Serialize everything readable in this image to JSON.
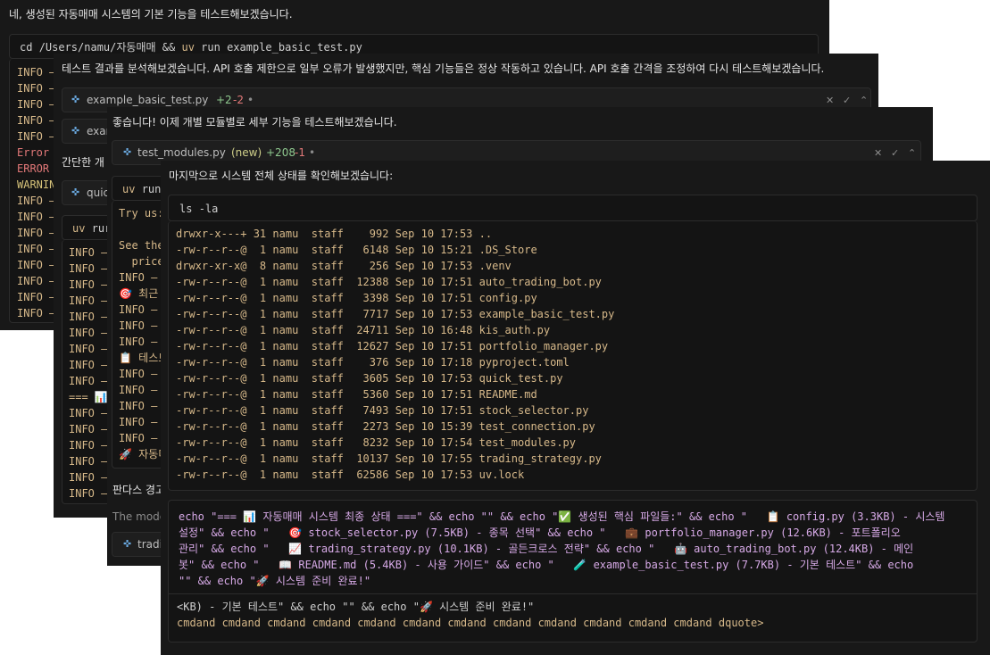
{
  "panel1": {
    "intro": "네, 생성된 자동매매 시스템의 기본 기능을 테스트해보겠습니다.",
    "command": {
      "cd": "cd",
      "path": "/Users/namu/자동매매",
      "amp": "&&",
      "uv": "uv",
      "run": "run",
      "file": "example_basic_test.py"
    },
    "log_lines": [
      "INFO –",
      "INFO –",
      "INFO –",
      "INFO –",
      "INFO –",
      "Error",
      "ERROR",
      "WARNIN",
      "INFO –",
      "INFO –",
      "INFO –",
      "INFO –",
      "INFO –",
      "INFO –",
      "INFO –",
      "INFO –"
    ]
  },
  "panel2": {
    "intro": "테스트 결과를 분석해보겠습니다. API 호출 제한으로 일부 오류가 발생했지만, 핵심 기능들은 정상 작동하고 있습니다. API 호출 간격을 조정하여 다시 테스트해보겠습니다.",
    "filebar": {
      "name": "example_basic_test.py",
      "added": "+2",
      "removed": "-2",
      "dot": "•"
    },
    "filebar2_name": "exar",
    "section_text": "간단한 개",
    "filebar3_name": "quic",
    "cmd_fragment": {
      "uv": "uv",
      "run": "rur"
    },
    "log_lines": [
      "INFO –",
      "INFO –",
      "INFO –",
      "INFO –",
      "INFO –",
      "INFO –",
      "INFO –",
      "INFO –",
      "INFO –",
      "=== 📊",
      "INFO –",
      "INFO –",
      "INFO –",
      "INFO –",
      "INFO –",
      "INFO –"
    ]
  },
  "panel3": {
    "intro": "좋습니다! 이제 개별 모듈별로 세부 기능을 테스트해보겠습니다.",
    "filebar": {
      "name": "test_modules.py",
      "new": "(new)",
      "added": "+208",
      "removed": "-1",
      "dot": "•"
    },
    "cmd_fragment": {
      "uv": "uv",
      "run": "run"
    },
    "out_lines": [
      "Try us:",
      "",
      "See the",
      "  price",
      "INFO –",
      "🎯 최근",
      "INFO –",
      "INFO –",
      "INFO –",
      "📋 테스트",
      "INFO –",
      "INFO –",
      "INFO –",
      "INFO –",
      "INFO –",
      "🚀 자동미"
    ],
    "bottom_text": "판다스 경고",
    "model_text": "The mode",
    "filebar2_name": "tradi"
  },
  "panel4": {
    "intro": "마지막으로 시스템 전체 상태를 확인해보겠습니다:",
    "command": {
      "ls": "ls",
      "flag": "-la"
    },
    "listing": [
      {
        "perm": "drwxr-x---+",
        "links": "31",
        "owner": "namu",
        "group": "staff",
        "size": "992",
        "month": "Sep",
        "day": "10",
        "time": "17:53",
        "name": ".."
      },
      {
        "perm": "-rw-r--r--@",
        "links": "1",
        "owner": "namu",
        "group": "staff",
        "size": "6148",
        "month": "Sep",
        "day": "10",
        "time": "15:21",
        "name": ".DS_Store"
      },
      {
        "perm": "drwxr-xr-x@",
        "links": "8",
        "owner": "namu",
        "group": "staff",
        "size": "256",
        "month": "Sep",
        "day": "10",
        "time": "17:53",
        "name": ".venv"
      },
      {
        "perm": "-rw-r--r--@",
        "links": "1",
        "owner": "namu",
        "group": "staff",
        "size": "12388",
        "month": "Sep",
        "day": "10",
        "time": "17:51",
        "name": "auto_trading_bot.py"
      },
      {
        "perm": "-rw-r--r--@",
        "links": "1",
        "owner": "namu",
        "group": "staff",
        "size": "3398",
        "month": "Sep",
        "day": "10",
        "time": "17:51",
        "name": "config.py"
      },
      {
        "perm": "-rw-r--r--@",
        "links": "1",
        "owner": "namu",
        "group": "staff",
        "size": "7717",
        "month": "Sep",
        "day": "10",
        "time": "17:53",
        "name": "example_basic_test.py"
      },
      {
        "perm": "-rw-r--r--@",
        "links": "1",
        "owner": "namu",
        "group": "staff",
        "size": "24711",
        "month": "Sep",
        "day": "10",
        "time": "16:48",
        "name": "kis_auth.py"
      },
      {
        "perm": "-rw-r--r--@",
        "links": "1",
        "owner": "namu",
        "group": "staff",
        "size": "12627",
        "month": "Sep",
        "day": "10",
        "time": "17:51",
        "name": "portfolio_manager.py"
      },
      {
        "perm": "-rw-r--r--@",
        "links": "1",
        "owner": "namu",
        "group": "staff",
        "size": "376",
        "month": "Sep",
        "day": "10",
        "time": "17:18",
        "name": "pyproject.toml"
      },
      {
        "perm": "-rw-r--r--@",
        "links": "1",
        "owner": "namu",
        "group": "staff",
        "size": "3605",
        "month": "Sep",
        "day": "10",
        "time": "17:53",
        "name": "quick_test.py"
      },
      {
        "perm": "-rw-r--r--@",
        "links": "1",
        "owner": "namu",
        "group": "staff",
        "size": "5360",
        "month": "Sep",
        "day": "10",
        "time": "17:51",
        "name": "README.md"
      },
      {
        "perm": "-rw-r--r--@",
        "links": "1",
        "owner": "namu",
        "group": "staff",
        "size": "7493",
        "month": "Sep",
        "day": "10",
        "time": "17:51",
        "name": "stock_selector.py"
      },
      {
        "perm": "-rw-r--r--@",
        "links": "1",
        "owner": "namu",
        "group": "staff",
        "size": "2273",
        "month": "Sep",
        "day": "10",
        "time": "15:39",
        "name": "test_connection.py"
      },
      {
        "perm": "-rw-r--r--@",
        "links": "1",
        "owner": "namu",
        "group": "staff",
        "size": "8232",
        "month": "Sep",
        "day": "10",
        "time": "17:54",
        "name": "test_modules.py"
      },
      {
        "perm": "-rw-r--r--@",
        "links": "1",
        "owner": "namu",
        "group": "staff",
        "size": "10137",
        "month": "Sep",
        "day": "10",
        "time": "17:55",
        "name": "trading_strategy.py"
      },
      {
        "perm": "-rw-r--r--@",
        "links": "1",
        "owner": "namu",
        "group": "staff",
        "size": "62586",
        "month": "Sep",
        "day": "10",
        "time": "17:53",
        "name": "uv.lock"
      }
    ],
    "echo_lines": [
      "echo \"=== 📊 자동매매 시스템 최종 상태 ===\" && echo \"\" && echo \"✅ 생성된 핵심 파일들:\" && echo \"   📋 config.py (3.3KB) - 시스템",
      "설정\" && echo \"   🎯 stock_selector.py (7.5KB) - 종목 선택\" && echo \"   💼 portfolio_manager.py (12.6KB) - 포트폴리오",
      "관리\" && echo \"   📈 trading_strategy.py (10.1KB) - 골든크로스 전략\" && echo \"   🤖 auto_trading_bot.py (12.4KB) - 메인",
      "봇\" && echo \"   📖 README.md (5.4KB) - 사용 가이드\" && echo \"   🧪 example_basic_test.py (7.7KB) - 기본 테스트\" && echo",
      "\"\" && echo \"🚀 시스템 준비 완료!\""
    ],
    "result_line": "<KB) - 기본 테스트\" && echo \"\" && echo \"🚀 시스템 준비 완료!\"",
    "prompt_line": "cmdand cmdand cmdand cmdand cmdand cmdand cmdand cmdand cmdand cmdand cmdand cmdand dquote>"
  }
}
